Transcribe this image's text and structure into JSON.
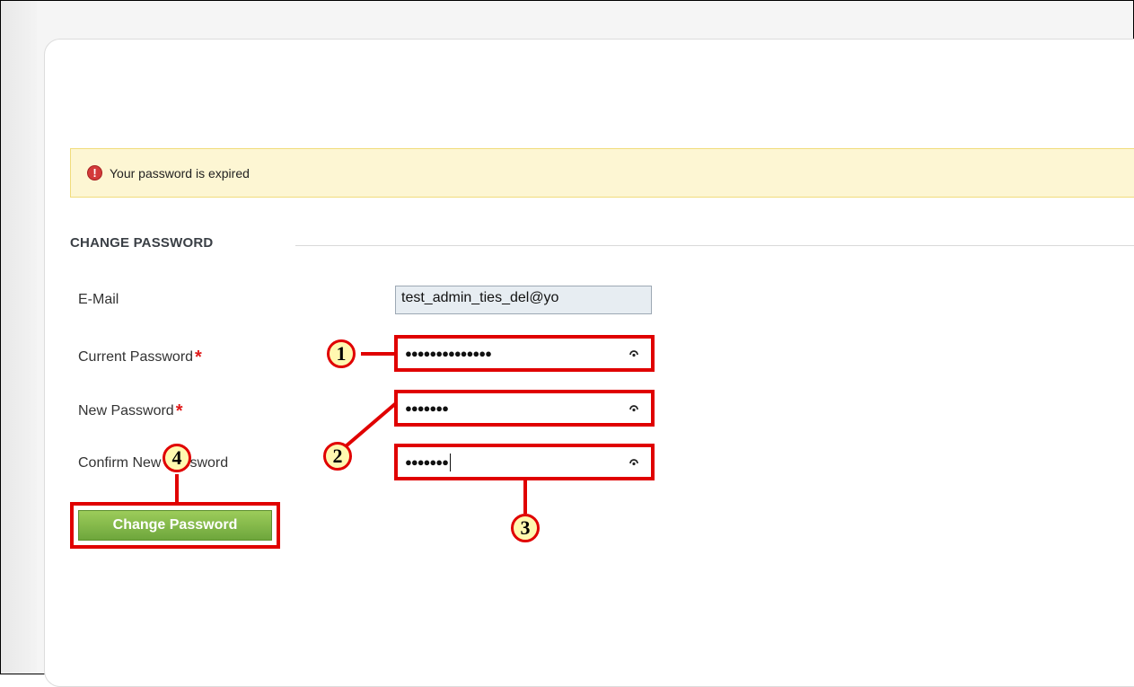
{
  "alert": {
    "message": "Your password is expired",
    "icon": "error-icon"
  },
  "section": {
    "title": "CHANGE PASSWORD"
  },
  "form": {
    "email_label": "E-Mail",
    "email_value": "test_admin_ties_del@yo",
    "current_password_label": "Current Password",
    "current_password_dots": "●●●●●●●●●●●●●●",
    "new_password_label": "New Password",
    "new_password_dots": "●●●●●●●",
    "confirm_password_label": "Confirm New Password",
    "confirm_password_dots": "●●●●●●●",
    "required_mark": "*"
  },
  "button": {
    "change_password_label": "Change Password"
  },
  "callouts": {
    "c1": "1",
    "c2": "2",
    "c3": "3",
    "c4": "4"
  },
  "colors": {
    "highlight": "#e00000",
    "alert_bg": "#fdf6d3",
    "button_green": "#7ab648"
  }
}
